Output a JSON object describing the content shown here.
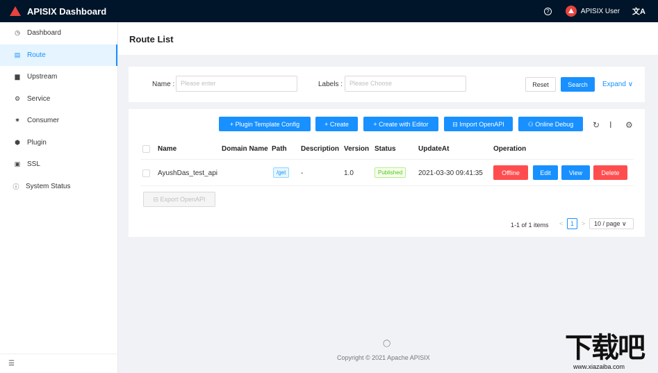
{
  "header": {
    "app_title": "APISIX Dashboard",
    "help_icon_glyph": "?",
    "user_name": "APISIX User",
    "lang_icon_glyph": "文A"
  },
  "sidebar": {
    "items": [
      {
        "label": "Dashboard",
        "icon": "dashboard-icon",
        "glyph": "◷"
      },
      {
        "label": "Route",
        "icon": "route-icon",
        "glyph": "▤"
      },
      {
        "label": "Upstream",
        "icon": "upstream-icon",
        "glyph": "▆"
      },
      {
        "label": "Service",
        "icon": "service-icon",
        "glyph": "⚙"
      },
      {
        "label": "Consumer",
        "icon": "consumer-icon",
        "glyph": "✷"
      },
      {
        "label": "Plugin",
        "icon": "plugin-icon",
        "glyph": "⬢"
      },
      {
        "label": "SSL",
        "icon": "ssl-icon",
        "glyph": "▣"
      },
      {
        "label": "System Status",
        "icon": "info-icon",
        "glyph": "ⓘ"
      }
    ],
    "active_index": 1,
    "collapse_glyph": "☰"
  },
  "page": {
    "title": "Route List"
  },
  "search": {
    "name_label": "Name :",
    "name_placeholder": "Please enter",
    "labels_label": "Labels :",
    "labels_placeholder": "Please Choose",
    "reset_label": "Reset",
    "search_label": "Search",
    "expand_label": "Expand ∨"
  },
  "toolbar": {
    "plugin_template_label": "+ Plugin Template Config",
    "create_label": "+ Create",
    "create_editor_label": "+ Create with Editor",
    "import_label": "⊟ Import OpenAPI",
    "debug_label": "⚇ Online Debug",
    "reload_glyph": "↻",
    "density_glyph": "Ⅰ",
    "settings_glyph": "⚙"
  },
  "table": {
    "columns": [
      "Name",
      "Domain Name",
      "Path",
      "Description",
      "Version",
      "Status",
      "UpdateAt",
      "Operation"
    ],
    "rows": [
      {
        "name": "AyushDas_test_api",
        "domain": "",
        "path": "/get",
        "description": "-",
        "version": "1.0",
        "status": "Published",
        "update_at": "2021-03-30 09:41:35",
        "actions": [
          "Offline",
          "Edit",
          "View",
          "Delete"
        ]
      }
    ],
    "export_label": "⊟ Export OpenAPI"
  },
  "pagination": {
    "summary": "1-1 of 1 items",
    "prev_glyph": "<",
    "current_page": "1",
    "next_glyph": ">",
    "page_size": "10 / page ∨"
  },
  "footer": {
    "github_glyph": "◯",
    "copyright": "Copyright © 2021 Apache APISIX"
  },
  "watermark": {
    "text": "下载吧",
    "url": "www.xiazaiba.com"
  },
  "colors": {
    "header_bg": "#001529",
    "primary": "#1890ff",
    "danger": "#ff4d4f",
    "success": "#52c41a",
    "brand_red": "#e8433e"
  }
}
